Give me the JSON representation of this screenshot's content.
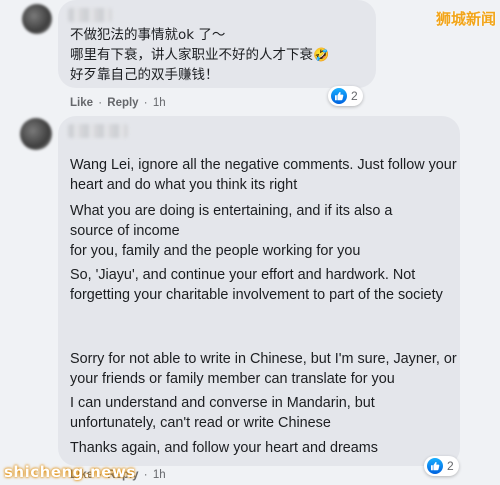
{
  "watermark": {
    "top_right": "狮城新闻",
    "bottom_left": "shicheng.news"
  },
  "comment1": {
    "lines": [
      "不做犯法的事情就ok 了～",
      "哪里有下衰，讲人家职业不好的人才下衰",
      "好歹靠自己的双手赚钱！"
    ],
    "emoji": "🤣",
    "like_label": "Like",
    "reply_label": "Reply",
    "separator": "·",
    "time": "1h",
    "reaction_count": "2"
  },
  "comment2": {
    "paragraphs": [
      "Wang Lei, ignore all the negative comments. Just follow your heart and do what you think its right",
      "What you are doing is entertaining, and if its also a source of income",
      "for you, family and the people working for you",
      "So, 'Jiayu', and continue your effort and hardwork. Not forgetting your charitable involvement to part of the society",
      "Sorry for not able to write in Chinese, but I'm sure, Jayner, or your friends or family member can translate for you",
      "I can understand and converse in Mandarin, but unfortunately, can't read or write Chinese",
      "Thanks again, and follow your heart and dreams"
    ],
    "like_label": "Like",
    "reply_label": "Reply",
    "separator": "·",
    "time": "1h",
    "reaction_count": "2"
  },
  "icons": {
    "reaction": "like-thumb-icon",
    "avatar": "user-avatar-blurred"
  },
  "colors": {
    "bubble": "#e4e6eb",
    "background": "#f0f2f5",
    "like_blue": "#1877f2",
    "watermark_orange": "#f2a51a"
  }
}
